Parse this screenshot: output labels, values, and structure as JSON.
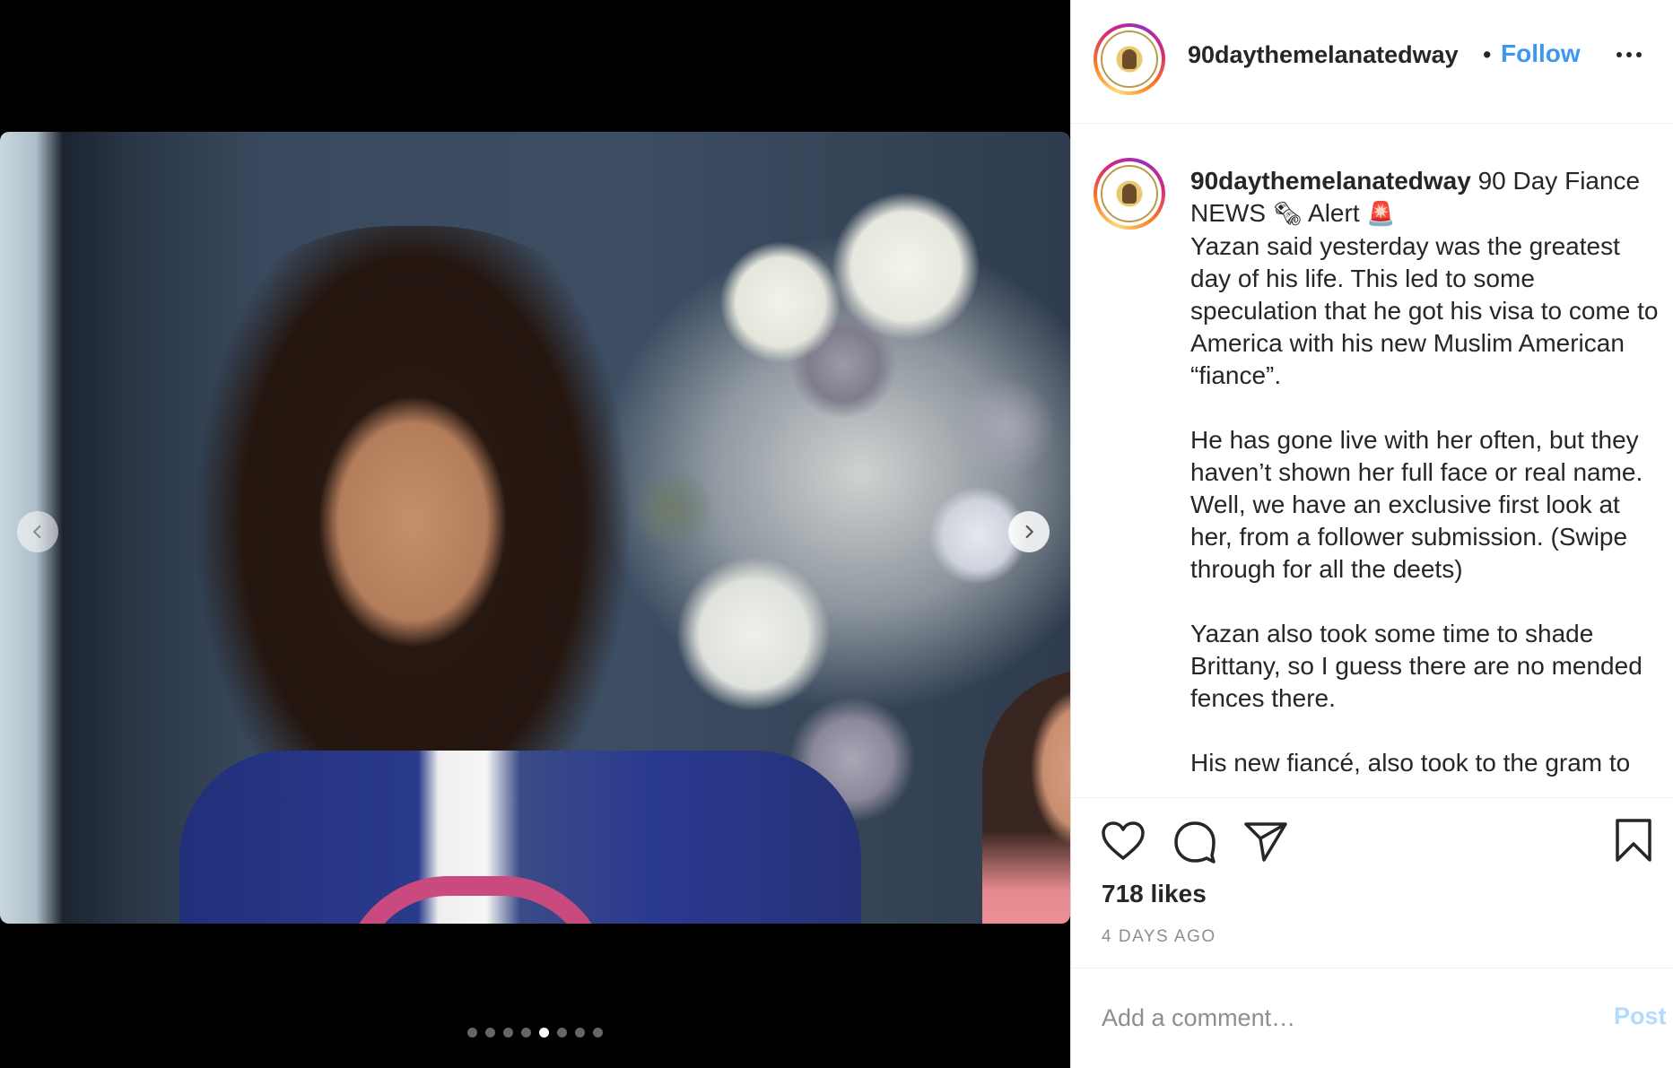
{
  "header": {
    "username": "90daythemelanatedway",
    "separator": "•",
    "follow_label": "Follow",
    "avatar_icon": "brand-seal-avatar",
    "more_icon": "more-options-icon"
  },
  "media": {
    "prev_icon": "chevron-left-icon",
    "next_icon": "chevron-right-icon",
    "carousel_count": 8,
    "carousel_active_index": 4
  },
  "caption": {
    "username": "90daythemelanatedway",
    "headline": "90 Day Fiance NEWS",
    "newspaper_emoji": "🗞",
    "alert_word": "Alert",
    "siren_emoji": "🚨",
    "paragraphs": [
      "Yazan said yesterday was the greatest day of his life. This led to some speculation that he got his visa to come to America with his new Muslim American “fiance”.",
      "He has gone live with her often, but they haven’t shown her full face or real name. Well, we have an exclusive first look at her, from a follower submission. (Swipe through for all the deets)",
      "Yazan also took some time to shade Brittany, so I guess there are no mended fences there.",
      "His new fiancé, also took to the gram to"
    ]
  },
  "actions": {
    "like_icon": "heart-icon",
    "comment_icon": "comment-bubble-icon",
    "share_icon": "paper-plane-icon",
    "save_icon": "bookmark-icon",
    "likes_text": "718 likes",
    "time_text": "4 DAYS AGO"
  },
  "comment": {
    "placeholder": "Add a comment…",
    "post_label": "Post"
  },
  "colors": {
    "accent": "#3c97f0",
    "post_disabled": "#b3dbff",
    "muted": "#8e8e8e",
    "text": "#262626"
  }
}
